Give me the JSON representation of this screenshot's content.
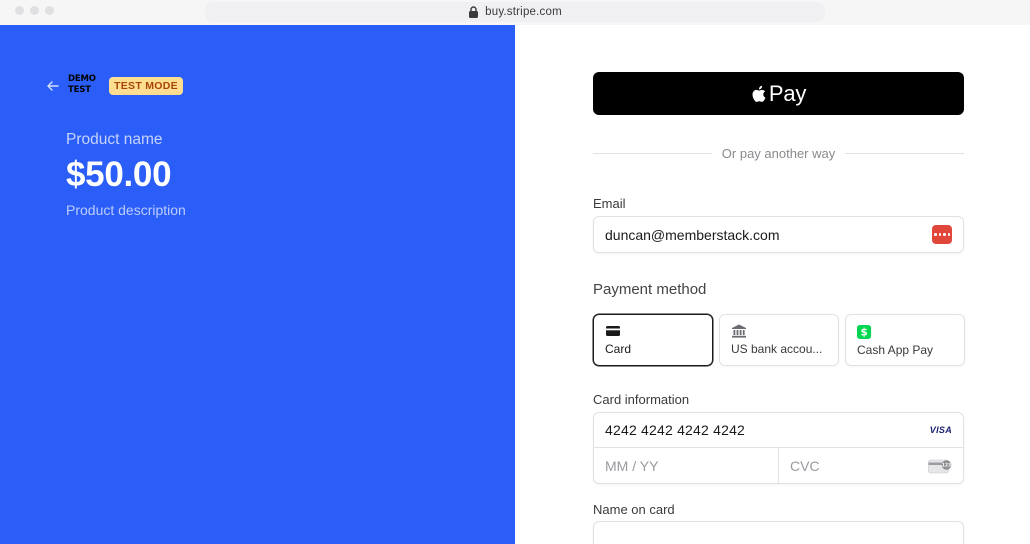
{
  "browser": {
    "url": "buy.stripe.com"
  },
  "merchant": {
    "logo_line1": "DEMO",
    "logo_line2": "TEST",
    "badge": "TEST MODE"
  },
  "product": {
    "name": "Product name",
    "price": "$50.00",
    "description": "Product description"
  },
  "checkout": {
    "apple_pay_label": "Pay",
    "divider_text": "Or pay another way",
    "email_label": "Email",
    "email_value": "duncan@memberstack.com",
    "payment_method_title": "Payment method",
    "payment_methods": [
      {
        "label": "Card",
        "icon": "credit-card-icon",
        "selected": true
      },
      {
        "label": "US bank accou...",
        "icon": "bank-icon",
        "selected": false
      },
      {
        "label": "Cash App Pay",
        "icon": "cash-app-icon",
        "selected": false
      }
    ],
    "card_info_label": "Card information",
    "card_number": "4242 4242 4242 4242",
    "card_brand": "VISA",
    "expiry_placeholder": "MM / YY",
    "cvc_placeholder": "CVC",
    "name_on_card_label": "Name on card"
  },
  "colors": {
    "left_pane": "#2b5ef8",
    "badge_bg": "#ffde92",
    "badge_text": "#a4460a",
    "password_manager": "#e0463a",
    "cash_app": "#00d64f"
  }
}
